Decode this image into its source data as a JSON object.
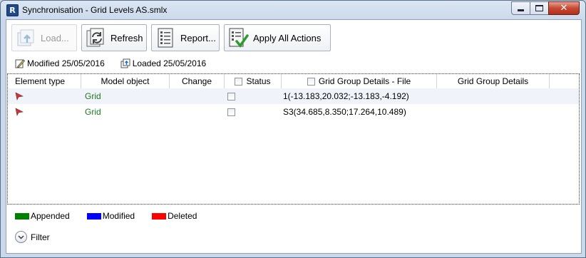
{
  "window": {
    "title": "Synchronisation - Grid Levels AS.smlx",
    "app_icon_letter": "R"
  },
  "toolbar": {
    "load_label": "Load...",
    "refresh_label": "Refresh",
    "report_label": "Report...",
    "apply_label": "Apply All Actions"
  },
  "info": {
    "modified": "Modified 25/05/2016",
    "loaded": "Loaded 25/05/2016"
  },
  "table": {
    "columns": [
      "Element type",
      "Model object",
      "Change",
      "Status",
      "Grid Group Details - File",
      "Grid Group Details"
    ],
    "rows": [
      {
        "model_object": "Grid",
        "change": "",
        "file_details": "1(-13.183,20.032;-13.183,-4.192)",
        "details": ""
      },
      {
        "model_object": "Grid",
        "change": "",
        "file_details": "S3(34.685,8.350;17.264,10.489)",
        "details": ""
      }
    ]
  },
  "legend": [
    {
      "label": "Appended",
      "color": "#008000"
    },
    {
      "label": "Modified",
      "color": "#0000ff"
    },
    {
      "label": "Deleted",
      "color": "#ff0000"
    }
  ],
  "filter": {
    "label": "Filter"
  },
  "icons": {
    "load": "load-icon",
    "refresh": "refresh-icon",
    "report": "report-icon",
    "apply": "apply-actions-icon",
    "modified": "pencil-document-icon",
    "loaded": "upload-document-icon",
    "row_marker": "red-flag-icon",
    "filter": "chevron-down-icon"
  }
}
